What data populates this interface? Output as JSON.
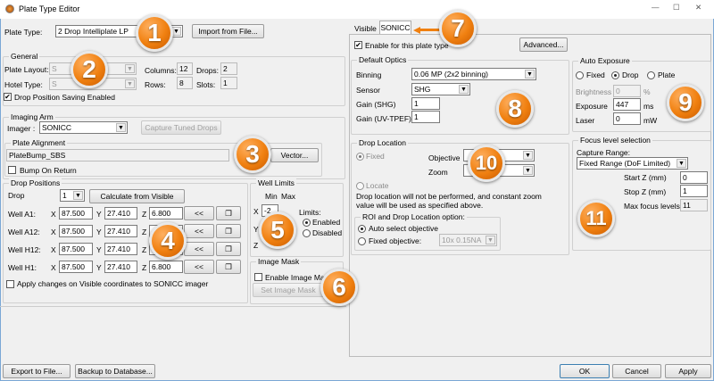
{
  "window": {
    "title": "Plate Type Editor"
  },
  "plate_type": {
    "label": "Plate Type:",
    "value": "2 Drop Intelliplate LP",
    "import_button": "Import from File..."
  },
  "general": {
    "legend": "General",
    "plate_layout_label": "Plate Layout:",
    "plate_layout_value": "S",
    "hotel_type_label": "Hotel Type:",
    "hotel_type_value": "S",
    "columns_label": "Columns:",
    "columns": "12",
    "drops_label": "Drops:",
    "drops": "2",
    "rows_label": "Rows:",
    "rows": "8",
    "slots_label": "Slots:",
    "slots": "1",
    "drop_saving_label": "Drop Position Saving Enabled",
    "drop_saving_checked": true
  },
  "imaging_arm": {
    "legend": "Imaging Arm",
    "imager_label": "Imager :",
    "imager_value": "SONICC",
    "capture_button": "Capture Tuned Drops"
  },
  "plate_alignment": {
    "legend": "Plate Alignment",
    "value": "PlateBump_SBS",
    "vector_button": "Vector...",
    "bump_label": "Bump On Return",
    "bump_checked": false
  },
  "drop_positions": {
    "legend": "Drop Positions",
    "drop_label": "Drop",
    "drop_value": "1",
    "calc_button": "Calculate from Visible",
    "copy_button": "<<",
    "wells": [
      {
        "label": "Well A1:",
        "x": "87.500",
        "y": "27.410",
        "z": "6.800"
      },
      {
        "label": "Well A12:",
        "x": "87.500",
        "y": "27.410",
        "z": ""
      },
      {
        "label": "Well H12:",
        "x": "87.500",
        "y": "27.410",
        "z": ""
      },
      {
        "label": "Well H1:",
        "x": "87.500",
        "y": "27.410",
        "z": "6.800"
      }
    ],
    "x_label": "X",
    "y_label": "Y",
    "z_label": "Z",
    "apply_label": "Apply changes on Visible coordinates to SONICC imager"
  },
  "well_limits": {
    "legend": "Well Limits",
    "min": "Min",
    "max": "Max",
    "x": "X",
    "y": "Y",
    "z": "Z",
    "x_min": "-2",
    "limits_label": "Limits:",
    "enabled": "Enabled",
    "disabled": "Disabled"
  },
  "image_mask": {
    "legend": "Image Mask",
    "enable_label": "Enable Image Mask",
    "set_button": "Set Image Mask"
  },
  "footer": {
    "export": "Export to File...",
    "backup": "Backup to Database...",
    "ok": "OK",
    "cancel": "Cancel",
    "apply": "Apply"
  },
  "tabs": [
    {
      "label": "Visible"
    },
    {
      "label": "SONICC",
      "selected": true
    }
  ],
  "sonicc": {
    "enable_label": "Enable for this plate type",
    "advanced": "Advanced...",
    "optics": {
      "legend": "Default Optics",
      "binning_label": "Binning",
      "binning": "0.06  MP (2x2 binning)",
      "sensor_label": "Sensor",
      "sensor": "SHG",
      "gain_shg_label": "Gain (SHG)",
      "gain_shg": "1",
      "gain_uv_label": "Gain (UV-TPEF)",
      "gain_uv": "1"
    },
    "exposure": {
      "legend": "Auto Exposure",
      "fixed": "Fixed",
      "drop": "Drop",
      "plate": "Plate",
      "brightness_label": "Brightness",
      "brightness": "0",
      "brightness_unit": "%",
      "exposure_label": "Exposure",
      "exposure": "447",
      "exposure_unit": "ms",
      "laser_label": "Laser",
      "laser": "0",
      "laser_unit": "mW"
    },
    "drop_location": {
      "legend": "Drop Location",
      "fixed": "Fixed",
      "locate": "Locate",
      "objective_label": "Objective",
      "zoom_label": "Zoom",
      "note1": "Drop location will not be performed, and constant zoom",
      "note2": "value will be used as specified above.",
      "roi_legend": "ROI and Drop Location option:",
      "auto": "Auto select objective",
      "fixed_obj": "Fixed objective:",
      "fixed_obj_value": "10x 0.15NA"
    },
    "focus": {
      "legend": "Focus level selection",
      "capture_label": "Capture Range:",
      "capture": "Fixed Range (DoF Limited)",
      "start_label": "Start Z (mm)",
      "start": "0",
      "stop_label": "Stop Z (mm)",
      "stop": "1",
      "max_label": "Max focus levels",
      "max": "11"
    }
  },
  "badges": [
    "1",
    "2",
    "3",
    "4",
    "5",
    "6",
    "7",
    "8",
    "9",
    "10",
    "11"
  ],
  "colors": {
    "accent": "#f08010",
    "window_border": "#7aa7d6"
  }
}
